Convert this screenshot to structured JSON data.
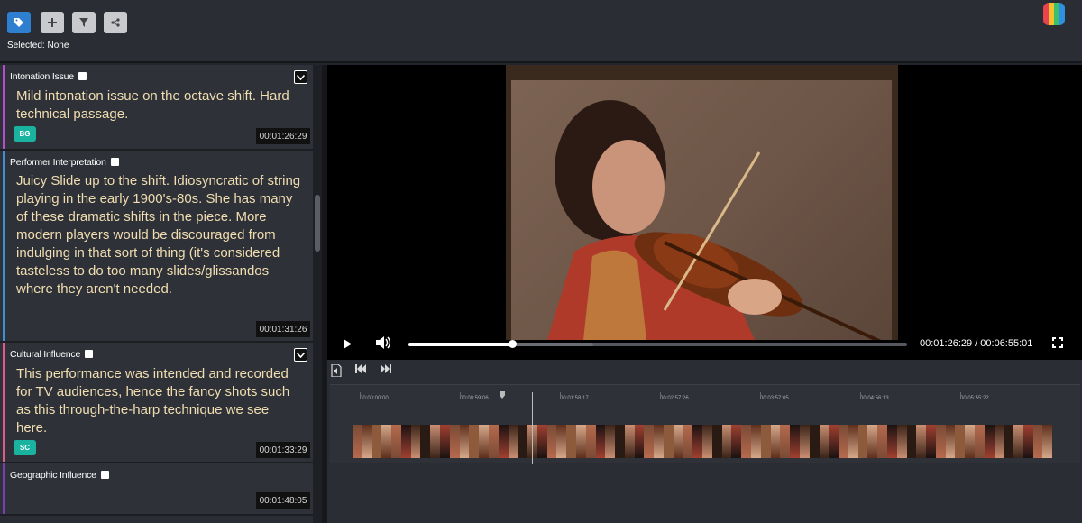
{
  "toolbar": {
    "buttons": [
      {
        "name": "tag-icon",
        "glyph": "🏷"
      },
      {
        "name": "plus-icon",
        "glyph": "+"
      },
      {
        "name": "filter-icon",
        "glyph": "▼"
      },
      {
        "name": "share-icon",
        "glyph": "<"
      }
    ],
    "selected_label": "Selected: None",
    "logo_colors": [
      "#e8434e",
      "#f6c12f",
      "#3cbf6a",
      "#2f8fe0"
    ]
  },
  "annotations": [
    {
      "category": "Intonation Issue",
      "text": "Mild intonation issue on the octave shift. Hard technical passage.",
      "badge": "BG",
      "timestamp": "00:01:26:29",
      "stripe_color": "#b24fd1",
      "has_chevron": true
    },
    {
      "category": "Performer Interpretation",
      "text": "Juicy Slide up to the shift. Idiosyncratic of string playing in the early 1900's-80s. She has many of these dramatic shifts in the piece. More modern players would be discouraged from indulging in that sort of thing (it's considered tasteless to do too many slides/glissandos where they aren't needed.",
      "badge": "",
      "timestamp": "00:01:31:26",
      "stripe_color": "#3f8fd6",
      "has_chevron": false
    },
    {
      "category": "Cultural Influence",
      "text": "This performance was intended and recorded for TV audiences, hence the fancy shots such as this through-the-harp technique we see here.",
      "badge": "SC",
      "timestamp": "00:01:33:29",
      "stripe_color": "#e05b8a",
      "has_chevron": true
    },
    {
      "category": "Geographic Influence",
      "text": "",
      "badge": "",
      "timestamp": "00:01:48:05",
      "stripe_color": "#7a3fb0",
      "has_chevron": false
    }
  ],
  "player": {
    "current_time": "00:01:26:29",
    "duration": "00:06:55:01",
    "time_display": "00:01:26:29 / 00:06:55:01",
    "progress_fraction": 0.208,
    "buffered_fraction": 0.37
  },
  "timeline": {
    "ticks": [
      "00:00:00:00",
      "00:00:59:06",
      "00:01:58:17",
      "00:02:57:26",
      "00:03:57:05",
      "00:04:56:13",
      "00:05:55:22"
    ],
    "playhead_fraction": 0.208
  }
}
